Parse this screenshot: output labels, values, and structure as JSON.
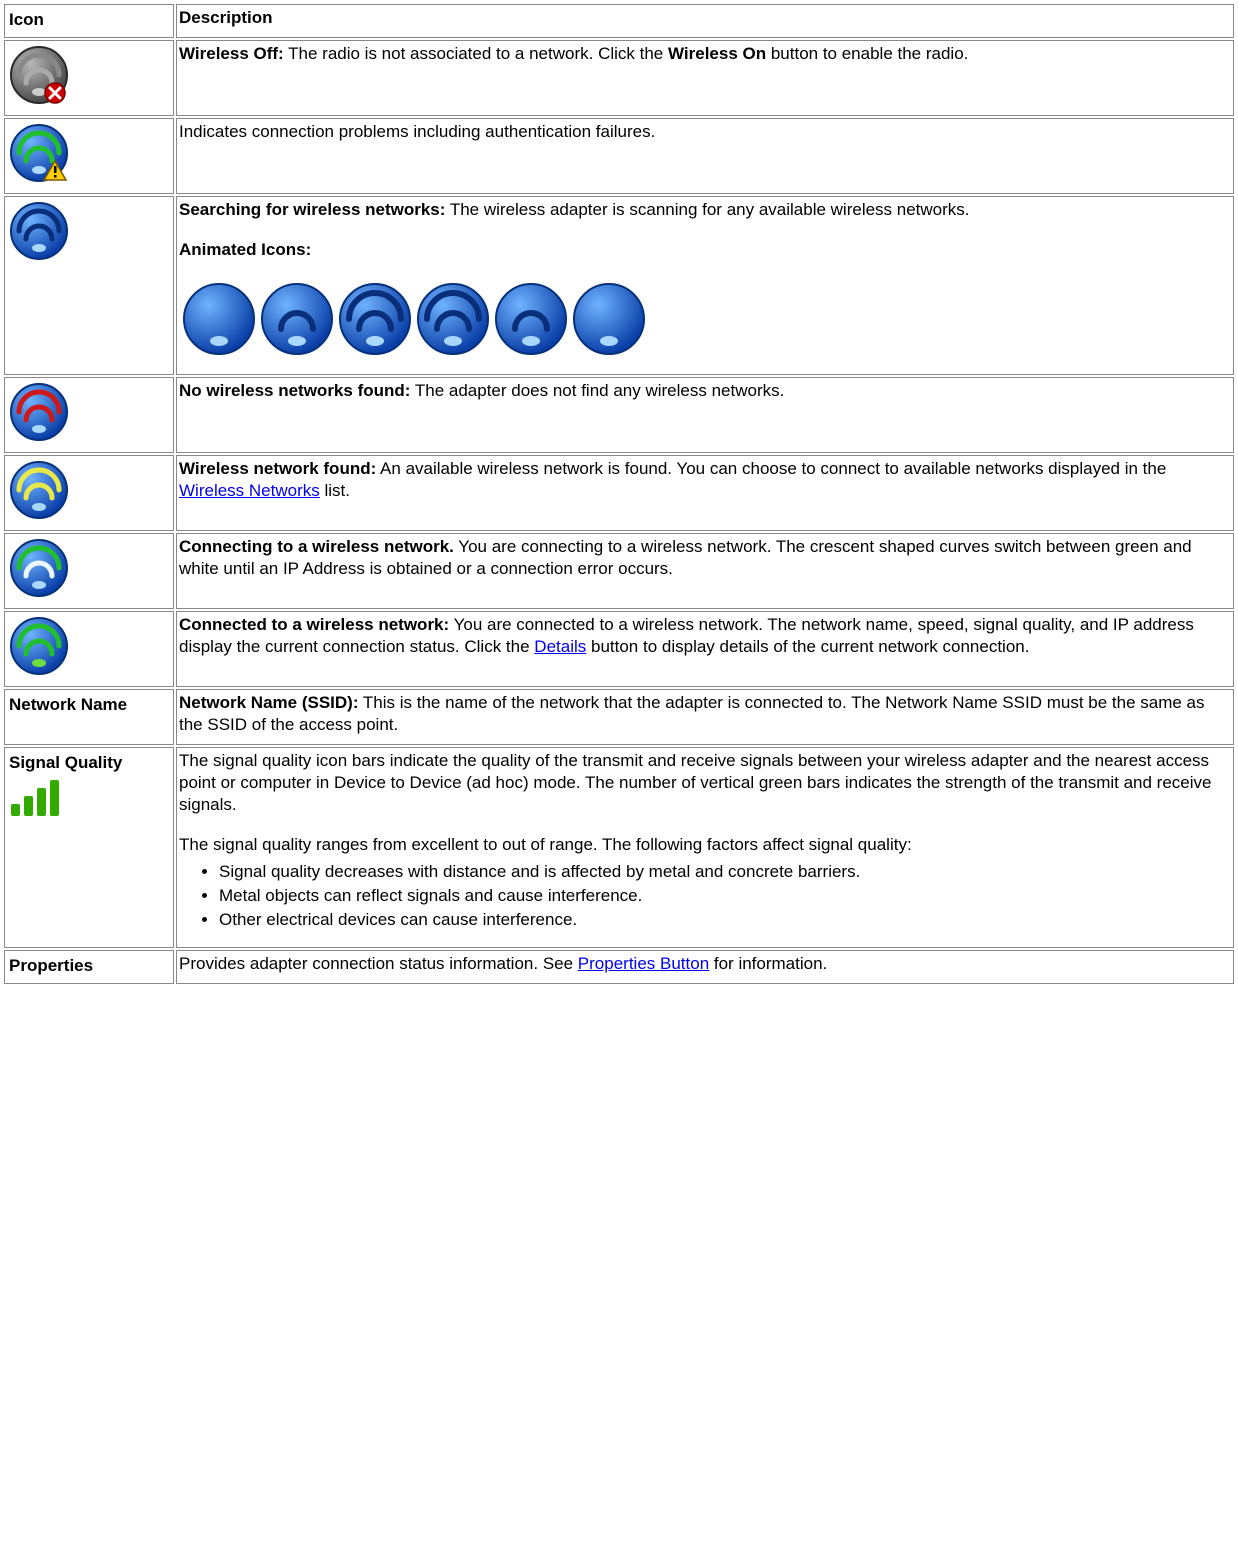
{
  "headers": {
    "icon": "Icon",
    "description": "Description"
  },
  "rows": {
    "wireless_off": {
      "title": "Wireless Off:",
      "rest": " The radio is not associated to a network. Click the ",
      "bold_button": "Wireless On",
      "tail": " button to enable the radio."
    },
    "conn_problems": {
      "text": "Indicates connection problems including authentication failures."
    },
    "searching": {
      "title": "Searching for wireless networks:",
      "rest": " The wireless adapter is scanning for any available wireless networks.",
      "animated_label": "Animated Icons:"
    },
    "no_networks": {
      "title": "No wireless networks found:",
      "rest": " The adapter does not find any wireless networks."
    },
    "found": {
      "title": "Wireless network found:",
      "rest": " An available wireless network is found. You can choose to connect to available networks displayed in the ",
      "link": "Wireless Networks",
      "tail": " list."
    },
    "connecting": {
      "title": "Connecting to a wireless network.",
      "rest": " You are connecting to a wireless network. The crescent shaped curves switch between green and white until an IP Address is obtained or a connection error occurs."
    },
    "connected": {
      "title": "Connected to a wireless network:",
      "rest": " You are connected to a wireless network. The network name, speed, signal quality, and IP address display the current connection status. Click the ",
      "link": "Details",
      "tail": " button to display details of the current network connection."
    },
    "network_name": {
      "label": "Network Name",
      "title": "Network Name (SSID):",
      "rest": " This is the name of the network that the adapter is connected to. The Network Name SSID must be the same as the SSID of the access point."
    },
    "signal_quality": {
      "label": "Signal Quality",
      "p1": "The signal quality icon bars indicate the quality of the transmit and receive signals between your wireless adapter and the nearest access point or computer in Device to Device (ad hoc) mode. The number of vertical green bars indicates the strength of the transmit and receive signals.",
      "p2": "The signal quality ranges from excellent to out of range. The following factors affect signal quality:",
      "bullets": [
        "Signal quality decreases with distance and is affected by metal and concrete barriers.",
        "Metal objects can reflect signals and cause interference.",
        "Other electrical devices can cause interference."
      ]
    },
    "properties": {
      "label": "Properties",
      "pre": "Provides adapter connection status information. See ",
      "link": "Properties Button",
      "tail": " for information."
    }
  }
}
